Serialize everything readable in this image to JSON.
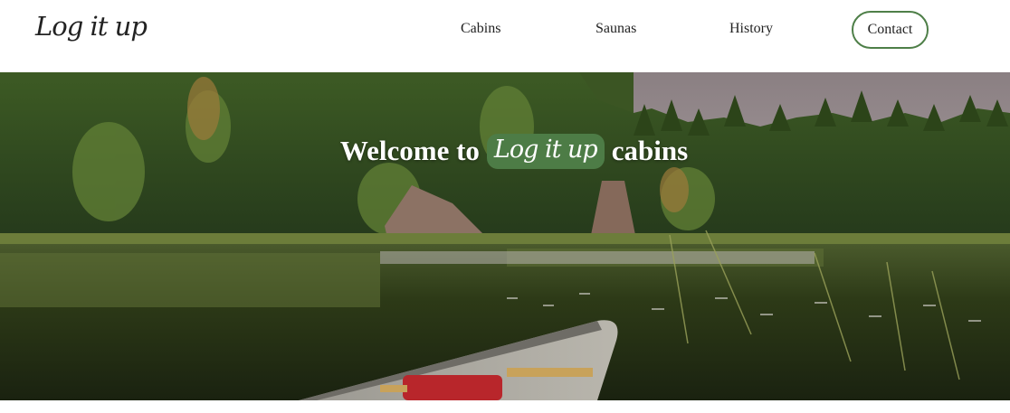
{
  "header": {
    "logo": "Log it up",
    "nav": {
      "cabins": "Cabins",
      "saunas": "Saunas",
      "history": "History",
      "contact": "Contact"
    }
  },
  "hero": {
    "welcome_prefix": "Welcome to",
    "welcome_brand": "Log it up",
    "welcome_suffix": "cabins",
    "image_description_icon": "lake-canoe-forest-photo"
  },
  "colors": {
    "accent_green": "#4d7c46",
    "text_dark": "#222222",
    "background": "#ffffff"
  }
}
